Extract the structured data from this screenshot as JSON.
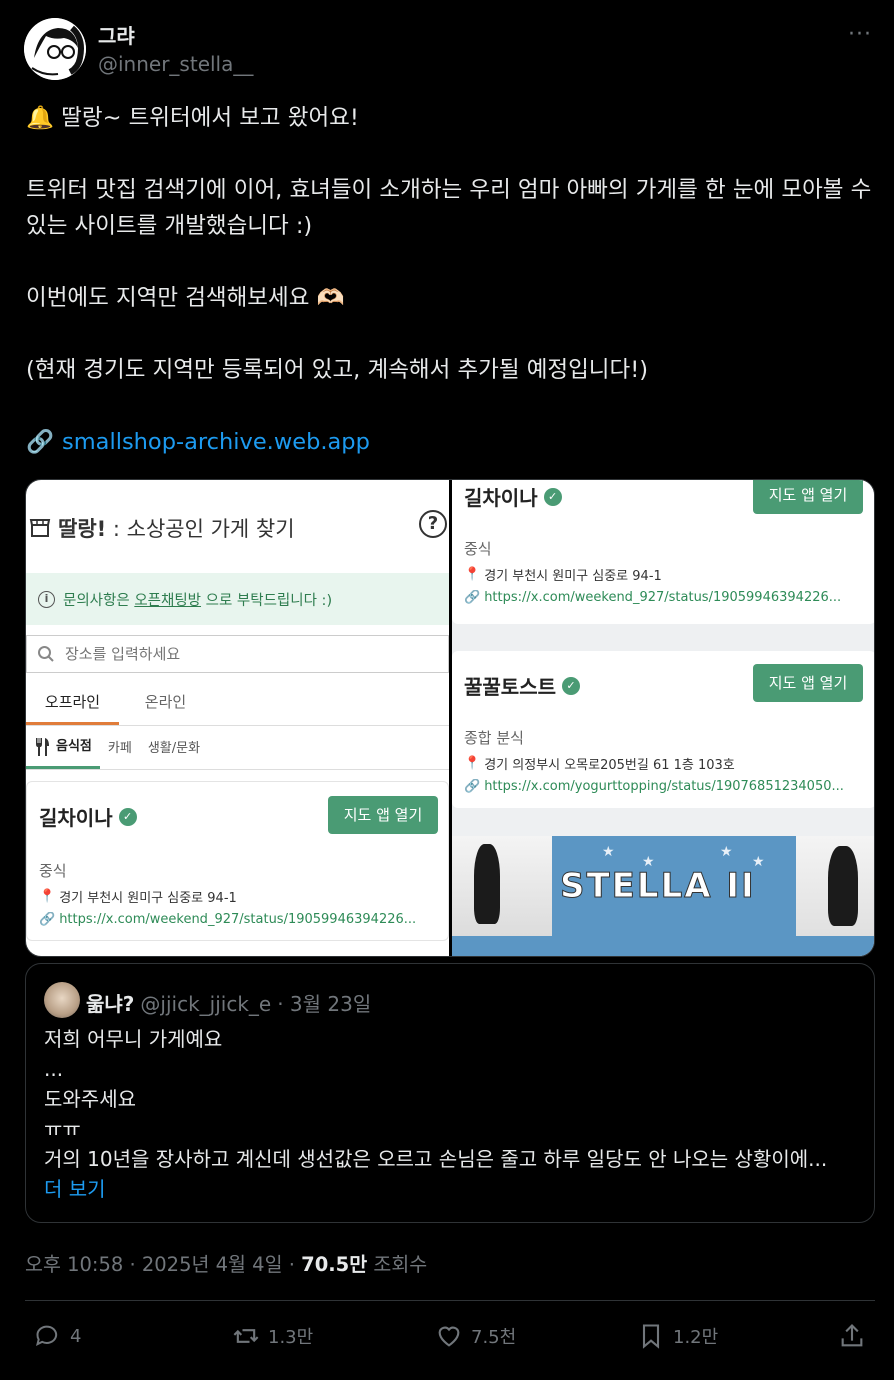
{
  "author": {
    "name": "그랴",
    "handle": "@inner_stella__"
  },
  "more_label": "···",
  "tweet": {
    "line1": "🔔 딸랑~  트위터에서 보고 왔어요!",
    "line2": "트위터 맛집 검색기에 이어, 효녀들이 소개하는 우리 엄마 아빠의 가게를 한 눈에 모아볼 수 있는 사이트를 개발했습니다 :)",
    "line3": "이번에도 지역만 검색해보세요 🫶🏻",
    "line4": "(현재 경기도 지역만 등록되어 있고, 계속해서 추가될 예정입니다!)",
    "link_icon": "🔗",
    "link": "smallshop-archive.web.app"
  },
  "app": {
    "title_bold": "딸랑!",
    "title_rest": " : 소상공인 가게 찾기",
    "help": "?",
    "notice_pre": "문의사항은 ",
    "notice_link": "오픈채팅방",
    "notice_post": " 으로 부탁드립니다 :)",
    "search_placeholder": "장소를 입력하세요",
    "tabs": [
      "오프라인",
      "온라인"
    ],
    "subtabs": [
      "음식점",
      "카페",
      "생활/문화"
    ],
    "map_button": "지도 앱 열기"
  },
  "shops": [
    {
      "name": "길차이나",
      "category": "중식",
      "address": "경기 부천시 원미구 심중로 94-1",
      "source": "https://x.com/weekend_927/status/19059946394226..."
    },
    {
      "name": "꿀꿀토스트",
      "category": "종합 분식",
      "address": "경기 의정부시 오목로205번길 61 1층 103호",
      "source": "https://x.com/yogurttopping/status/19076851234050..."
    }
  ],
  "banner_text": "STELLA II",
  "quote": {
    "name": "욺냐?",
    "handle": "@jjick_jjick_e",
    "date": "· 3월 23일",
    "lines": [
      "저희 어무니 가게예요",
      "...",
      "도와주세요",
      "ㅠㅠ",
      "거의 10년을 장사하고 계신데 생선값은 오르고 손님은 줄고 하루 일당도 안 나오는 상황이에..."
    ],
    "more": "더 보기"
  },
  "meta": {
    "time": "오후 10:58 · 2025년 4월 4일 · ",
    "views": "70.5만",
    "views_label": " 조회수"
  },
  "actions": {
    "replies": "4",
    "retweets": "1.3만",
    "likes": "7.5천",
    "bookmarks": "1.2만"
  },
  "colors": {
    "background": "#000000",
    "text": "#e7e9ea",
    "muted": "#71767b",
    "link": "#1d9bf0",
    "app_green": "#4a9b74",
    "app_orange": "#e07c3a"
  }
}
